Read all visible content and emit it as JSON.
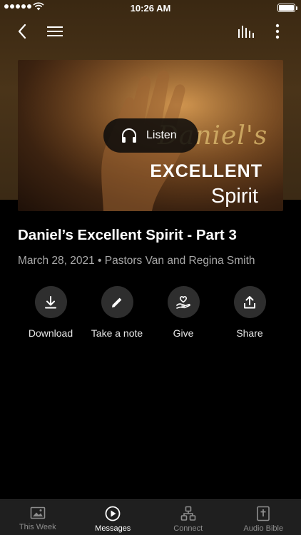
{
  "status_bar": {
    "time": "10:26 AM"
  },
  "artwork": {
    "script_title": "Daniel's",
    "line1": "EXCELLENT",
    "line2": "Spirit",
    "listen_label": "Listen"
  },
  "message": {
    "title": "Daniel’s Excellent Spirit - Part 3",
    "meta": "March 28, 2021 • Pastors Van and Regina Smith"
  },
  "actions": [
    {
      "label": "Download",
      "icon": "download-icon"
    },
    {
      "label": "Take a note",
      "icon": "pencil-icon"
    },
    {
      "label": "Give",
      "icon": "give-heart-icon"
    },
    {
      "label": "Share",
      "icon": "share-icon"
    }
  ],
  "tabs": [
    {
      "label": "This Week",
      "icon": "image-icon",
      "active": false
    },
    {
      "label": "Messages",
      "icon": "play-circle-icon",
      "active": true
    },
    {
      "label": "Connect",
      "icon": "connect-icon",
      "active": false
    },
    {
      "label": "Audio Bible",
      "icon": "bible-icon",
      "active": false
    }
  ],
  "colors": {
    "background": "#000000",
    "hero_brown": "#4a3419",
    "action_circle": "#2e2e2e",
    "tab_bar": "#1f1f1f",
    "meta_text": "#a9a9a9"
  }
}
